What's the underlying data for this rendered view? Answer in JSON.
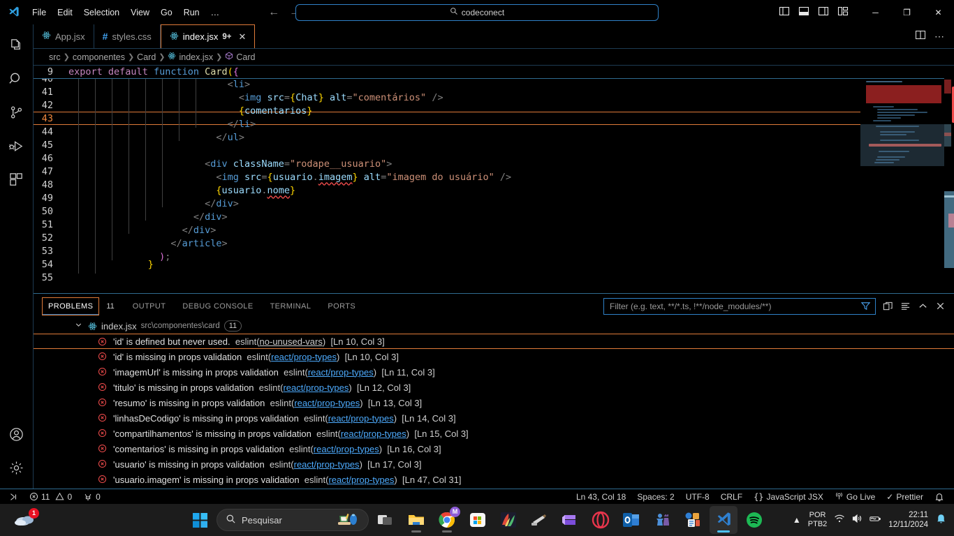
{
  "window": {
    "title_menu": [
      "File",
      "Edit",
      "Selection",
      "View",
      "Go",
      "Run",
      "…"
    ],
    "command_center_text": "codeconect",
    "nav_back_icon": "arrow-left-icon",
    "nav_forward_icon": "arrow-right-icon",
    "layout_icons": [
      "toggle-primary-sidebar-icon",
      "toggle-panel-icon",
      "toggle-secondary-sidebar-icon",
      "customize-layout-icon"
    ],
    "controls": {
      "minimize": "─",
      "maximize": "❐",
      "close": "✕"
    }
  },
  "activitybar": {
    "items": [
      {
        "name": "explorer",
        "label": "Explorer"
      },
      {
        "name": "search",
        "label": "Search"
      },
      {
        "name": "source-control",
        "label": "Source Control"
      },
      {
        "name": "run-debug",
        "label": "Run and Debug"
      },
      {
        "name": "extensions",
        "label": "Extensions"
      }
    ],
    "bottom": [
      {
        "name": "accounts",
        "label": "Accounts"
      },
      {
        "name": "settings",
        "label": "Manage"
      }
    ]
  },
  "tabs": [
    {
      "label": "App.jsx",
      "icon": "react-icon",
      "active": false,
      "badge": "",
      "dirty": false
    },
    {
      "label": "styles.css",
      "icon": "css-icon",
      "active": false,
      "badge": "",
      "dirty": false
    },
    {
      "label": "index.jsx",
      "icon": "react-icon",
      "active": true,
      "badge": "9+",
      "close": "✕"
    }
  ],
  "tab_actions": [
    "split-editor-icon",
    "more-actions-icon"
  ],
  "breadcrumb": [
    {
      "label": "src",
      "icon": ""
    },
    {
      "label": "componentes",
      "icon": ""
    },
    {
      "label": "Card",
      "icon": ""
    },
    {
      "label": "index.jsx",
      "icon": "react-icon"
    },
    {
      "label": "Card",
      "icon": "symbol-class-icon"
    }
  ],
  "editor": {
    "sticky_line": {
      "number": "9",
      "text": "export default function Card({"
    },
    "current_line": 43,
    "lines": [
      {
        "n": "40",
        "text": "<li>",
        "indent": 7
      },
      {
        "n": "41",
        "text": "<img src={Chat} alt=\"comentários\" />",
        "indent": 8
      },
      {
        "n": "42",
        "text": "{comentarios}",
        "indent": 8
      },
      {
        "n": "43",
        "text": "</li>",
        "indent": 7
      },
      {
        "n": "44",
        "text": "</ul>",
        "indent": 6
      },
      {
        "n": "45",
        "text": "",
        "indent": 0
      },
      {
        "n": "46",
        "text": "<div className=\"rodape__usuario\">",
        "indent": 5
      },
      {
        "n": "47",
        "text": "<img src={usuario.imagem} alt=\"imagem do usuário\" />",
        "indent": 6
      },
      {
        "n": "48",
        "text": "{usuario.nome}",
        "indent": 6
      },
      {
        "n": "49",
        "text": "</div>",
        "indent": 5
      },
      {
        "n": "50",
        "text": "</div>",
        "indent": 4
      },
      {
        "n": "51",
        "text": "</div>",
        "indent": 3
      },
      {
        "n": "52",
        "text": "</article>",
        "indent": 3
      },
      {
        "n": "53",
        "text": ");",
        "indent": 2
      },
      {
        "n": "54",
        "text": "}",
        "indent": 1
      },
      {
        "n": "55",
        "text": "",
        "indent": 0
      }
    ]
  },
  "panel": {
    "tabs": [
      {
        "label": "PROBLEMS",
        "count": "11",
        "active": true
      },
      {
        "label": "OUTPUT",
        "count": "",
        "active": false
      },
      {
        "label": "DEBUG CONSOLE",
        "count": "",
        "active": false
      },
      {
        "label": "TERMINAL",
        "count": "",
        "active": false
      },
      {
        "label": "PORTS",
        "count": "",
        "active": false
      }
    ],
    "filter": {
      "placeholder": "Filter (e.g. text, **/*.ts, !**/node_modules/**)",
      "value": ""
    },
    "actions": [
      "filter-icon",
      "collapse-all-icon",
      "view-as-table-icon",
      "chevron-up-icon",
      "close-icon"
    ],
    "group": {
      "file": "index.jsx",
      "path": "src\\componentes\\card",
      "count": "11",
      "expanded": true
    },
    "problems": [
      {
        "quote": "'id'",
        "message": "is defined but never used.",
        "rule_prefix": "eslint(",
        "rule": "no-unused-vars",
        "rule_suffix": ")",
        "rule_is_link": false,
        "location": "[Ln 10, Col 3]",
        "selected": true
      },
      {
        "quote": "'id'",
        "message": "is missing in props validation",
        "rule_prefix": "eslint(",
        "rule": "react/prop-types",
        "rule_suffix": ")",
        "rule_is_link": true,
        "location": "[Ln 10, Col 3]",
        "selected": false
      },
      {
        "quote": "'imagemUrl'",
        "message": "is missing in props validation",
        "rule_prefix": "eslint(",
        "rule": "react/prop-types",
        "rule_suffix": ")",
        "rule_is_link": true,
        "location": "[Ln 11, Col 3]",
        "selected": false
      },
      {
        "quote": "'titulo'",
        "message": "is missing in props validation",
        "rule_prefix": "eslint(",
        "rule": "react/prop-types",
        "rule_suffix": ")",
        "rule_is_link": true,
        "location": "[Ln 12, Col 3]",
        "selected": false
      },
      {
        "quote": "'resumo'",
        "message": "is missing in props validation",
        "rule_prefix": "eslint(",
        "rule": "react/prop-types",
        "rule_suffix": ")",
        "rule_is_link": true,
        "location": "[Ln 13, Col 3]",
        "selected": false
      },
      {
        "quote": "'linhasDeCodigo'",
        "message": "is missing in props validation",
        "rule_prefix": "eslint(",
        "rule": "react/prop-types",
        "rule_suffix": ")",
        "rule_is_link": true,
        "location": "[Ln 14, Col 3]",
        "selected": false
      },
      {
        "quote": "'compartilhamentos'",
        "message": "is missing in props validation",
        "rule_prefix": "eslint(",
        "rule": "react/prop-types",
        "rule_suffix": ")",
        "rule_is_link": true,
        "location": "[Ln 15, Col 3]",
        "selected": false
      },
      {
        "quote": "'comentarios'",
        "message": "is missing in props validation",
        "rule_prefix": "eslint(",
        "rule": "react/prop-types",
        "rule_suffix": ")",
        "rule_is_link": true,
        "location": "[Ln 16, Col 3]",
        "selected": false
      },
      {
        "quote": "'usuario'",
        "message": "is missing in props validation",
        "rule_prefix": "eslint(",
        "rule": "react/prop-types",
        "rule_suffix": ")",
        "rule_is_link": true,
        "location": "[Ln 17, Col 3]",
        "selected": false
      },
      {
        "quote": "'usuario.imagem'",
        "message": "is missing in props validation",
        "rule_prefix": "eslint(",
        "rule": "react/prop-types",
        "rule_suffix": ")",
        "rule_is_link": true,
        "location": "[Ln 47, Col 31]",
        "selected": false
      }
    ]
  },
  "statusbar": {
    "left": [
      {
        "name": "remote-indicator",
        "icon": "remote-icon",
        "label": ""
      },
      {
        "name": "problems-summary",
        "icon": "error-warning-icon",
        "label": "11  0"
      },
      {
        "name": "ports-summary",
        "icon": "ports-icon",
        "label": "0"
      }
    ],
    "errors": "11",
    "warnings": "0",
    "ports": "0",
    "right": [
      {
        "name": "editor-position",
        "label": "Ln 43, Col 18"
      },
      {
        "name": "indentation",
        "label": "Spaces: 2"
      },
      {
        "name": "encoding",
        "label": "UTF-8"
      },
      {
        "name": "eol",
        "label": "CRLF"
      },
      {
        "name": "language-mode",
        "label": "JavaScript JSX",
        "icon": "braces-icon"
      },
      {
        "name": "go-live",
        "label": "Go Live",
        "icon": "broadcast-icon"
      },
      {
        "name": "prettier",
        "label": "Prettier",
        "icon": "check-icon"
      },
      {
        "name": "notifications",
        "label": "",
        "icon": "bell-icon"
      }
    ]
  },
  "taskbar": {
    "weather": {
      "badge": "1",
      "icon": "weather-cloud-icon"
    },
    "start_icon": "windows-start-icon",
    "search": {
      "placeholder": "Pesquisar",
      "icon": "search-icon"
    },
    "apps": [
      {
        "name": "task-view",
        "color": "#9a9a9a"
      },
      {
        "name": "file-explorer",
        "color": "#ffc83d"
      },
      {
        "name": "google-chrome",
        "color": "#4285f4",
        "badge": "M"
      },
      {
        "name": "microsoft-store",
        "color": "#ffffff"
      },
      {
        "name": "paint-art-app",
        "color": "#c94f3d"
      },
      {
        "name": "snipping-tool",
        "color": "#8d6e4a"
      },
      {
        "name": "clipchamp",
        "color": "#8b5cf6"
      },
      {
        "name": "opera-browser",
        "color": "#e8354c"
      },
      {
        "name": "microsoft-outlook",
        "color": "#0f6cbd"
      },
      {
        "name": "chess-app",
        "color": "#5b8dd6"
      },
      {
        "name": "office-app",
        "color": "#2a7de1"
      },
      {
        "name": "visual-studio-code",
        "color": "#2f80d0",
        "active": true
      },
      {
        "name": "spotify",
        "color": "#1db954"
      }
    ],
    "tray": {
      "chevron": "chevron-up-icon",
      "language_line1": "POR",
      "language_line2": "PTB2",
      "icons": [
        "wifi-icon",
        "volume-icon",
        "battery-icon"
      ],
      "time": "22:11",
      "date": "12/11/2024",
      "notification_icon": "bell-icon"
    }
  },
  "colors": {
    "accent_orange": "#e07b39",
    "accent_blue": "#2f81c7",
    "error_red": "#f14c4c",
    "link_blue": "#4daafc"
  }
}
